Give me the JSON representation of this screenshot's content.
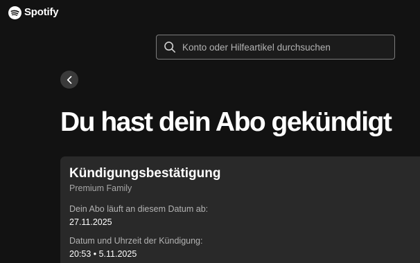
{
  "header": {
    "brand_name": "Spotify",
    "brand_icon": "spotify-logo-icon"
  },
  "search": {
    "placeholder": "Konto oder Hilfeartikel durchsuchen",
    "icon": "search-icon"
  },
  "navigation": {
    "back_icon": "chevron-left-icon"
  },
  "main": {
    "title": "Du hast dein Abo gekündigt"
  },
  "confirmation": {
    "title": "Kündigungsbestätigung",
    "plan": "Premium Family",
    "fields": [
      {
        "label": "Dein Abo läuft an diesem Datum ab:",
        "value": "27.11.2025"
      },
      {
        "label": "Datum und Uhrzeit der Kündigung:",
        "value": "20:53 • 5.11.2025"
      }
    ]
  },
  "colors": {
    "background": "#121212",
    "card": "#292929",
    "text_primary": "#ffffff",
    "text_secondary": "#b3b3b3",
    "search_border": "#7c7c7c"
  }
}
